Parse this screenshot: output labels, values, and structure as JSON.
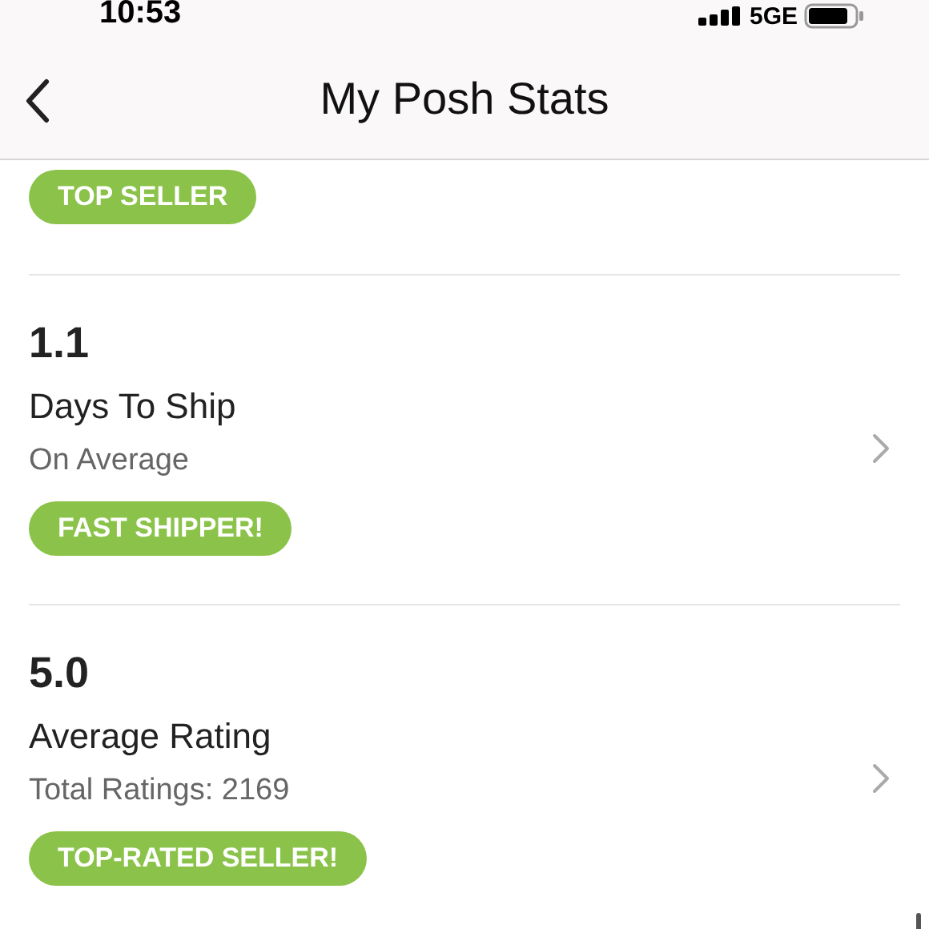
{
  "status_bar": {
    "time": "10:53",
    "network": "5GE"
  },
  "header": {
    "title": "My Posh Stats"
  },
  "stats": [
    {
      "badge": "TOP SELLER"
    },
    {
      "value": "1.1",
      "label": "Days To Ship",
      "detail": "On Average",
      "badge": "FAST SHIPPER!"
    },
    {
      "value": "5.0",
      "label": "Average Rating",
      "detail": "Total Ratings: 2169",
      "badge": "TOP-RATED SELLER!"
    }
  ]
}
